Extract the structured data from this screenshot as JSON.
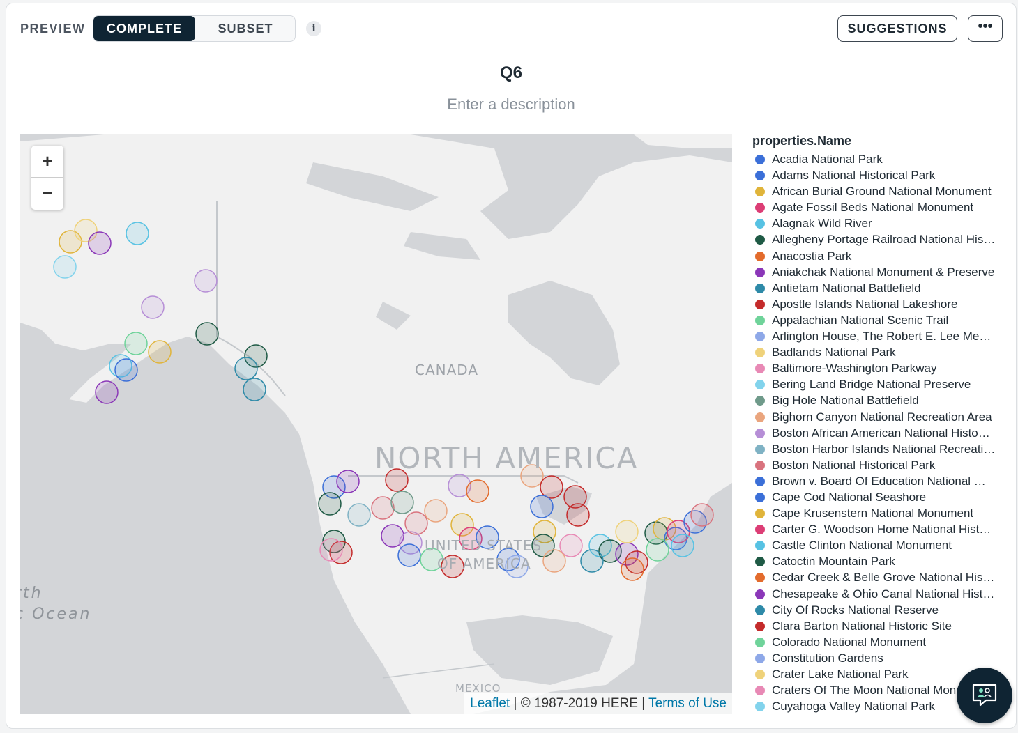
{
  "toolbar": {
    "preview_label": "PREVIEW",
    "toggle_options": [
      "COMPLETE",
      "SUBSET"
    ],
    "active_toggle": "COMPLETE",
    "info_glyph": "i",
    "suggestions_label": "SUGGESTIONS",
    "more_glyph": "•••"
  },
  "chart": {
    "title": "Q6",
    "description_placeholder": "Enter a description"
  },
  "map": {
    "zoom_in": "+",
    "zoom_out": "−",
    "labels": {
      "canada": "CANADA",
      "continent": "NORTH AMERICA",
      "us_line1": "UNITED STATES",
      "us_line2": "OF AMERICA",
      "mexico": "MEXICO",
      "ocean_line1": "rth",
      "ocean_line2": "c Ocean"
    },
    "attribution": {
      "leaflet": "Leaflet",
      "separator1": " | ",
      "copyright": "© 1987-2019 HERE",
      "separator2": " | ",
      "terms": "Terms of Use"
    },
    "colors": {
      "water": "#d3d5d8",
      "land": "#f1f1f1",
      "border": "#c4c8cc"
    }
  },
  "legend": {
    "title": "properties.Name",
    "items": [
      {
        "label": "Acadia National Park",
        "color": "#3b6fd8"
      },
      {
        "label": "Adams National Historical Park",
        "color": "#3b6fd8"
      },
      {
        "label": "African Burial Ground National Monument",
        "color": "#e0b43a"
      },
      {
        "label": "Agate Fossil Beds National Monument",
        "color": "#dc3d75"
      },
      {
        "label": "Alagnak Wild River",
        "color": "#57c2e3"
      },
      {
        "label": "Allegheny Portage Railroad National His…",
        "color": "#1f5a45"
      },
      {
        "label": "Anacostia Park",
        "color": "#e36b2c"
      },
      {
        "label": "Aniakchak National Monument & Preserve",
        "color": "#8b37b8"
      },
      {
        "label": "Antietam National Battlefield",
        "color": "#2e8aa8"
      },
      {
        "label": "Apostle Islands National Lakeshore",
        "color": "#c42b2b"
      },
      {
        "label": "Appalachian National Scenic Trail",
        "color": "#6fd39a"
      },
      {
        "label": "Arlington House, The Robert  E. Lee Me…",
        "color": "#8ea8e8"
      },
      {
        "label": "Badlands National Park",
        "color": "#efd27a"
      },
      {
        "label": "Baltimore-Washington Parkway",
        "color": "#e889b5"
      },
      {
        "label": "Bering Land Bridge National Preserve",
        "color": "#82d3ec"
      },
      {
        "label": "Big Hole National Battlefield",
        "color": "#6f9a8a"
      },
      {
        "label": "Bighorn Canyon National Recreation Area",
        "color": "#eaa57e"
      },
      {
        "label": "Boston African American National Histo…",
        "color": "#b68ed6"
      },
      {
        "label": "Boston Harbor Islands National Recreati…",
        "color": "#7fb2c4"
      },
      {
        "label": "Boston National Historical Park",
        "color": "#d9737e"
      },
      {
        "label": "Brown v. Board Of Education National …",
        "color": "#3b6fd8"
      },
      {
        "label": "Cape Cod National Seashore",
        "color": "#3b6fd8"
      },
      {
        "label": "Cape Krusenstern National Monument",
        "color": "#e0b43a"
      },
      {
        "label": "Carter G. Woodson Home National Hist…",
        "color": "#dc3d75"
      },
      {
        "label": "Castle Clinton National Monument",
        "color": "#57c2e3"
      },
      {
        "label": "Catoctin Mountain Park",
        "color": "#1f5a45"
      },
      {
        "label": "Cedar Creek & Belle Grove National His…",
        "color": "#e36b2c"
      },
      {
        "label": "Chesapeake & Ohio Canal National Hist…",
        "color": "#8b37b8"
      },
      {
        "label": "City Of Rocks National Reserve",
        "color": "#2e8aa8"
      },
      {
        "label": "Clara Barton National Historic Site",
        "color": "#c42b2b"
      },
      {
        "label": "Colorado National Monument",
        "color": "#6fd39a"
      },
      {
        "label": "Constitution Gardens",
        "color": "#8ea8e8"
      },
      {
        "label": "Crater Lake National Park",
        "color": "#efd27a"
      },
      {
        "label": "Craters Of The Moon National Monument",
        "color": "#e889b5"
      },
      {
        "label": "Cuyahoga Valley National Park",
        "color": "#82d3ec"
      }
    ]
  }
}
